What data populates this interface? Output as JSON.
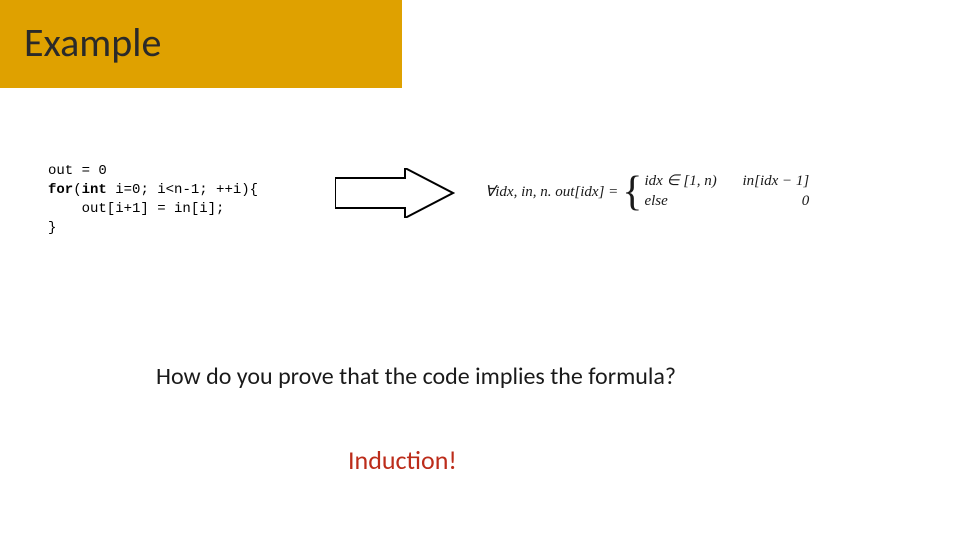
{
  "title": "Example",
  "code": {
    "line1": "out = 0",
    "kw_for": "for",
    "paren_open": "(",
    "kw_int": "int",
    "line2_rest": " i=0; i<n-1; ++i){",
    "line3": "    out[i+1] = in[i];",
    "line4": "}"
  },
  "formula": {
    "lead": "∀idx, in, n.  out[idx] =",
    "case1_cond": "idx ∈ [1, n)",
    "case1_val": "in[idx − 1]",
    "case2_cond": "else",
    "case2_val": "0"
  },
  "question": "How do you prove that the code implies the formula?",
  "answer": "Induction!"
}
